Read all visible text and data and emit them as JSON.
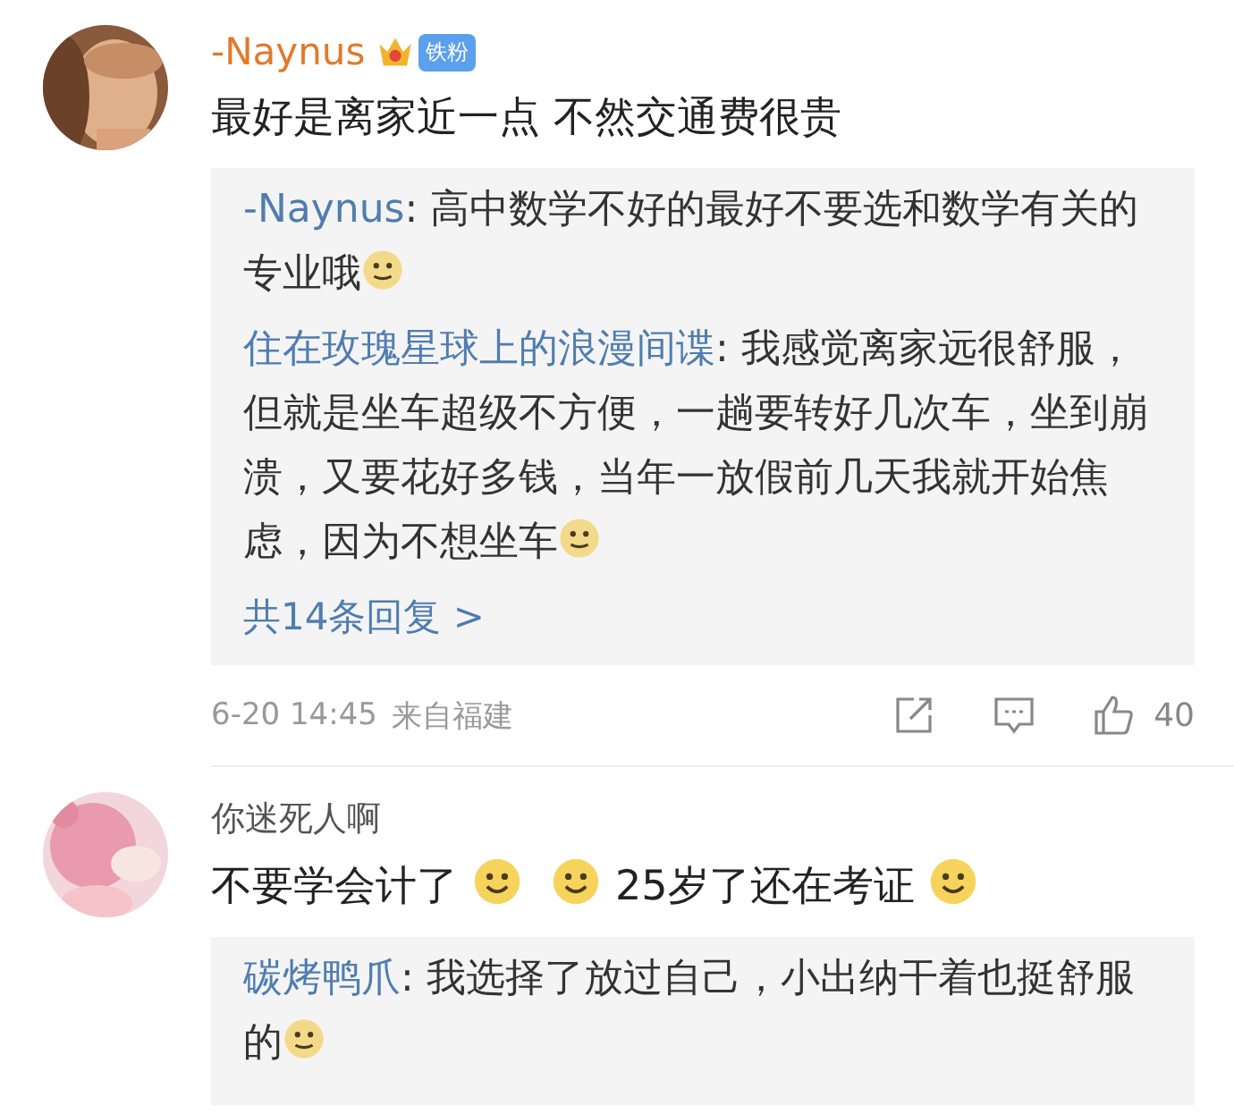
{
  "comments": [
    {
      "author": "-Naynus",
      "vip": true,
      "badge": {
        "label": "铁粉"
      },
      "body": [
        {
          "kind": "text",
          "text": "最好是离家近一点 不然交通费很贵"
        }
      ],
      "replies": [
        {
          "author": "-Naynus",
          "body": [
            {
              "kind": "text",
              "text": ": 高中数学不好的最好不要选和数学有关的专业哦"
            },
            {
              "kind": "emoji"
            }
          ]
        },
        {
          "author": "住在玫瑰星球上的浪漫间谍",
          "body": [
            {
              "kind": "text",
              "text": ": 我感觉离家远很舒服，但就是坐车超级不方便，一趟要转好几次车，坐到崩溃，又要花好多钱，当年一放假前几天我就开始焦虑，因为不想坐车"
            },
            {
              "kind": "emoji"
            }
          ]
        }
      ],
      "more_replies": "共14条回复 >",
      "meta": {
        "time": "6-20 14:45",
        "location": "来自福建",
        "likes": "40"
      }
    },
    {
      "author": "你迷死人啊",
      "vip": false,
      "body": [
        {
          "kind": "text",
          "text": "不要学会计了"
        },
        {
          "kind": "emoji"
        },
        {
          "kind": "emoji"
        },
        {
          "kind": "text",
          "text": "25岁了还在考证"
        },
        {
          "kind": "emoji"
        }
      ],
      "replies": [
        {
          "author": "碳烤鸭爪",
          "body": [
            {
              "kind": "text",
              "text": ": 我选择了放过自己，小出纳干着也挺舒服的"
            },
            {
              "kind": "emoji"
            }
          ]
        }
      ]
    }
  ]
}
